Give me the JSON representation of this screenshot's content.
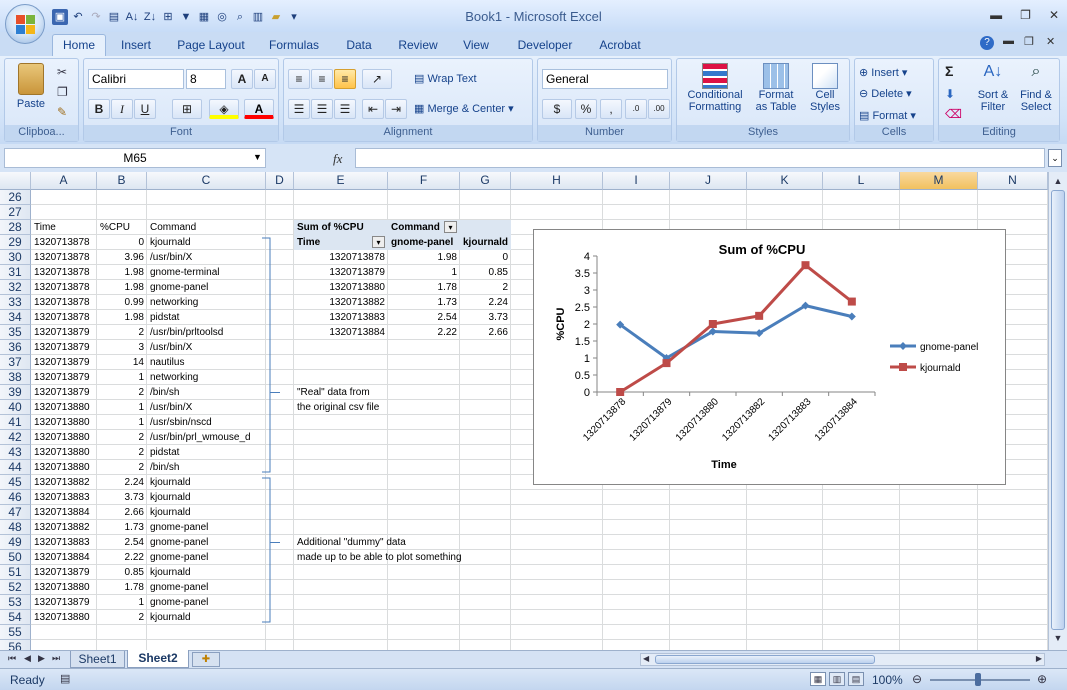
{
  "window": {
    "title": "Book1 - Microsoft Excel"
  },
  "tabs": [
    "Home",
    "Insert",
    "Page Layout",
    "Formulas",
    "Data",
    "Review",
    "View",
    "Developer",
    "Acrobat"
  ],
  "ribbon": {
    "clipboard": {
      "label": "Clipboa...",
      "paste": "Paste"
    },
    "font": {
      "label": "Font",
      "name": "Calibri",
      "size": "8",
      "bold": "B",
      "italic": "I",
      "underline": "U"
    },
    "alignment": {
      "label": "Alignment",
      "wrap": "Wrap Text",
      "merge": "Merge & Center"
    },
    "number": {
      "label": "Number",
      "format": "General",
      "dollar": "$",
      "percent": "%",
      "comma": ","
    },
    "styles": {
      "label": "Styles",
      "conditional": "Conditional",
      "conditional2": "Formatting",
      "format_table": "Format",
      "format_table2": "as Table",
      "cell_styles": "Cell",
      "cell_styles2": "Styles"
    },
    "cells": {
      "label": "Cells",
      "insert": "Insert",
      "delete": "Delete",
      "format": "Format"
    },
    "editing": {
      "label": "Editing",
      "sum": "Σ",
      "sort": "Sort &",
      "sort2": "Filter",
      "find": "Find &",
      "find2": "Select"
    }
  },
  "formula_bar": {
    "name_box": "M65",
    "fx": "fx",
    "value": ""
  },
  "columns": [
    "A",
    "B",
    "C",
    "D",
    "E",
    "F",
    "G",
    "H",
    "I",
    "J",
    "K",
    "L",
    "M",
    "N"
  ],
  "rows": [
    "26",
    "27",
    "28",
    "29",
    "30",
    "31",
    "32",
    "33",
    "34",
    "35",
    "36",
    "37",
    "38",
    "39",
    "40",
    "41",
    "42",
    "43",
    "44",
    "45",
    "46",
    "47",
    "48",
    "49",
    "50",
    "51",
    "52",
    "53",
    "54",
    "55",
    "56"
  ],
  "data_header": [
    "Time",
    "%CPU",
    "Command"
  ],
  "data_rows": [
    [
      "1320713878",
      "0",
      "kjournald"
    ],
    [
      "1320713878",
      "3.96",
      "/usr/bin/X"
    ],
    [
      "1320713878",
      "1.98",
      "gnome-terminal"
    ],
    [
      "1320713878",
      "1.98",
      "gnome-panel"
    ],
    [
      "1320713878",
      "0.99",
      "networking"
    ],
    [
      "1320713878",
      "1.98",
      "pidstat"
    ],
    [
      "1320713879",
      "2",
      "/usr/bin/prltoolsd"
    ],
    [
      "1320713879",
      "3",
      "/usr/bin/X"
    ],
    [
      "1320713879",
      "14",
      "nautilus"
    ],
    [
      "1320713879",
      "1",
      "networking"
    ],
    [
      "1320713879",
      "2",
      "/bin/sh"
    ],
    [
      "1320713880",
      "1",
      "/usr/bin/X"
    ],
    [
      "1320713880",
      "1",
      "/usr/sbin/nscd"
    ],
    [
      "1320713880",
      "2",
      "/usr/bin/prl_wmouse_d"
    ],
    [
      "1320713880",
      "2",
      "pidstat"
    ],
    [
      "1320713880",
      "2",
      "/bin/sh"
    ],
    [
      "1320713882",
      "2.24",
      "kjournald"
    ],
    [
      "1320713883",
      "3.73",
      "kjournald"
    ],
    [
      "1320713884",
      "2.66",
      "kjournald"
    ],
    [
      "1320713882",
      "1.73",
      "gnome-panel"
    ],
    [
      "1320713883",
      "2.54",
      "gnome-panel"
    ],
    [
      "1320713884",
      "2.22",
      "gnome-panel"
    ],
    [
      "1320713879",
      "0.85",
      "kjournald"
    ],
    [
      "1320713880",
      "1.78",
      "gnome-panel"
    ],
    [
      "1320713879",
      "1",
      "gnome-panel"
    ],
    [
      "1320713880",
      "2",
      "kjournald"
    ]
  ],
  "pivot": {
    "title": "Sum of %CPU",
    "col_field": "Command",
    "row_field": "Time",
    "col_headers": [
      "gnome-panel",
      "kjournald"
    ],
    "rows": [
      [
        "1320713878",
        "1.98",
        "0"
      ],
      [
        "1320713879",
        "1",
        "0.85"
      ],
      [
        "1320713880",
        "1.78",
        "2"
      ],
      [
        "1320713882",
        "1.73",
        "2.24"
      ],
      [
        "1320713883",
        "2.54",
        "3.73"
      ],
      [
        "1320713884",
        "2.22",
        "2.66"
      ]
    ]
  },
  "notes": {
    "real1": "\"Real\" data from",
    "real2": "the original csv file",
    "dummy1": "Additional \"dummy\" data",
    "dummy2": "made up to be able to plot something"
  },
  "chart_data": {
    "type": "line",
    "title": "Sum of  %CPU",
    "xlabel": "Time",
    "ylabel": "%CPU",
    "categories": [
      "1320713878",
      "1320713879",
      "1320713880",
      "1320713882",
      "1320713883",
      "1320713884"
    ],
    "series": [
      {
        "name": "gnome-panel",
        "values": [
          1.98,
          1,
          1.78,
          1.73,
          2.54,
          2.22
        ],
        "color": "#4a7ebb"
      },
      {
        "name": "kjournald",
        "values": [
          0,
          0.85,
          2,
          2.24,
          3.73,
          2.66
        ],
        "color": "#be4b48"
      }
    ],
    "ylim": [
      0,
      4
    ],
    "yticks": [
      "0",
      "0.5",
      "1",
      "1.5",
      "2",
      "2.5",
      "3",
      "3.5",
      "4"
    ],
    "legend": "right",
    "grid": false
  },
  "sheets": [
    "Sheet1",
    "Sheet2"
  ],
  "active_sheet": "Sheet2",
  "status": {
    "ready": "Ready",
    "zoom": "100%"
  }
}
